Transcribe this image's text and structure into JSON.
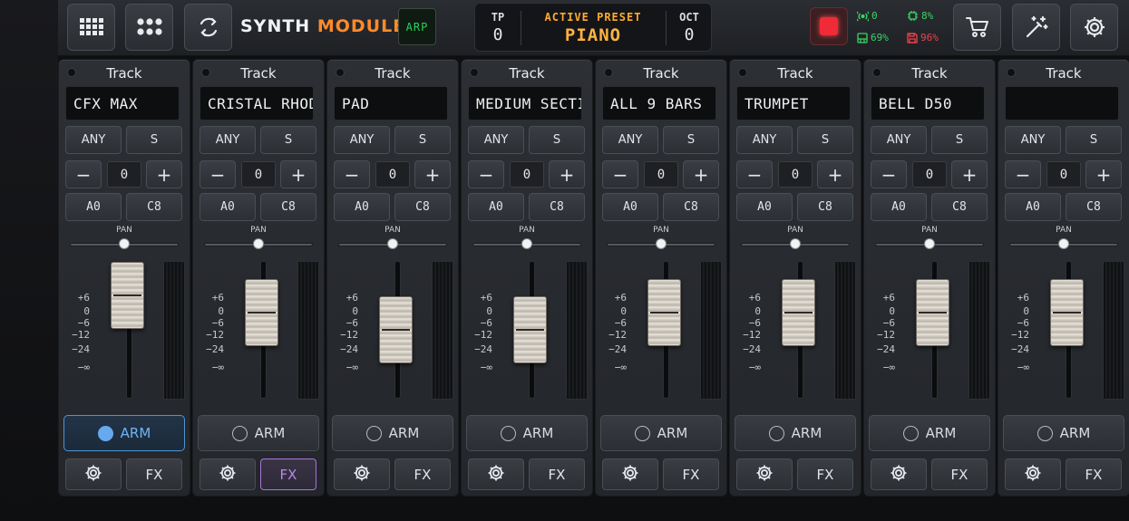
{
  "app": {
    "brand_word1": "SYNTH",
    "brand_word2": "MODULE",
    "arp_label": "ARP",
    "accent_color": "#ff8a2a"
  },
  "toolbar": {
    "left_buttons": [
      {
        "icon": "keyboard-grid-icon"
      },
      {
        "icon": "pads-grid-icon"
      },
      {
        "icon": "sync-cycle-icon"
      }
    ],
    "right_buttons": [
      {
        "icon": "cart-icon"
      },
      {
        "icon": "magic-wand-icon"
      },
      {
        "icon": "gear-icon"
      }
    ]
  },
  "preset_panel": {
    "tp_label": "TP",
    "tp_value": "0",
    "active_label": "ACTIVE PRESET",
    "active_value": "PIANO",
    "oct_label": "OCT",
    "oct_value": "0"
  },
  "status": {
    "midi": "0",
    "cpu": "8%",
    "memory": "69%",
    "disk": "96%"
  },
  "strips": [
    {
      "title": "Track",
      "name": "CFX MAX",
      "channel": "ANY",
      "mode": "S",
      "minus": "−",
      "value": "0",
      "plus": "+",
      "low_key": "A0",
      "high_key": "C8",
      "pan_label": "PAN",
      "pan": 0.5,
      "fader": 0.0,
      "arm_label": "ARM",
      "armed": true,
      "fx_label": "FX",
      "fx_active": false
    },
    {
      "title": "Track",
      "name": "CRISTAL RHODES",
      "channel": "ANY",
      "mode": "S",
      "minus": "−",
      "value": "0",
      "plus": "+",
      "low_key": "A0",
      "high_key": "C8",
      "pan_label": "PAN",
      "pan": 0.5,
      "fader": 0.25,
      "arm_label": "ARM",
      "armed": false,
      "fx_label": "FX",
      "fx_active": true
    },
    {
      "title": "Track",
      "name": "PAD",
      "channel": "ANY",
      "mode": "S",
      "minus": "−",
      "value": "0",
      "plus": "+",
      "low_key": "A0",
      "high_key": "C8",
      "pan_label": "PAN",
      "pan": 0.5,
      "fader": 0.5,
      "arm_label": "ARM",
      "armed": false,
      "fx_label": "FX",
      "fx_active": false
    },
    {
      "title": "Track",
      "name": "MEDIUM SECTION",
      "channel": "ANY",
      "mode": "S",
      "minus": "−",
      "value": "0",
      "plus": "+",
      "low_key": "A0",
      "high_key": "C8",
      "pan_label": "PAN",
      "pan": 0.5,
      "fader": 0.5,
      "arm_label": "ARM",
      "armed": false,
      "fx_label": "FX",
      "fx_active": false
    },
    {
      "title": "Track",
      "name": "ALL 9 BARS",
      "channel": "ANY",
      "mode": "S",
      "minus": "−",
      "value": "0",
      "plus": "+",
      "low_key": "A0",
      "high_key": "C8",
      "pan_label": "PAN",
      "pan": 0.5,
      "fader": 0.25,
      "arm_label": "ARM",
      "armed": false,
      "fx_label": "FX",
      "fx_active": false
    },
    {
      "title": "Track",
      "name": "TRUMPET",
      "channel": "ANY",
      "mode": "S",
      "minus": "−",
      "value": "0",
      "plus": "+",
      "low_key": "A0",
      "high_key": "C8",
      "pan_label": "PAN",
      "pan": 0.5,
      "fader": 0.25,
      "arm_label": "ARM",
      "armed": false,
      "fx_label": "FX",
      "fx_active": false
    },
    {
      "title": "Track",
      "name": "BELL D50",
      "channel": "ANY",
      "mode": "S",
      "minus": "−",
      "value": "0",
      "plus": "+",
      "low_key": "A0",
      "high_key": "C8",
      "pan_label": "PAN",
      "pan": 0.5,
      "fader": 0.25,
      "arm_label": "ARM",
      "armed": false,
      "fx_label": "FX",
      "fx_active": false
    },
    {
      "title": "Track",
      "name": "",
      "channel": "ANY",
      "mode": "S",
      "minus": "−",
      "value": "0",
      "plus": "+",
      "low_key": "A0",
      "high_key": "C8",
      "pan_label": "PAN",
      "pan": 0.5,
      "fader": 0.25,
      "arm_label": "ARM",
      "armed": false,
      "fx_label": "FX",
      "fx_active": false
    }
  ],
  "fader_scale": [
    "+6",
    "0",
    "−6",
    "−12",
    "−24",
    "−∞"
  ]
}
